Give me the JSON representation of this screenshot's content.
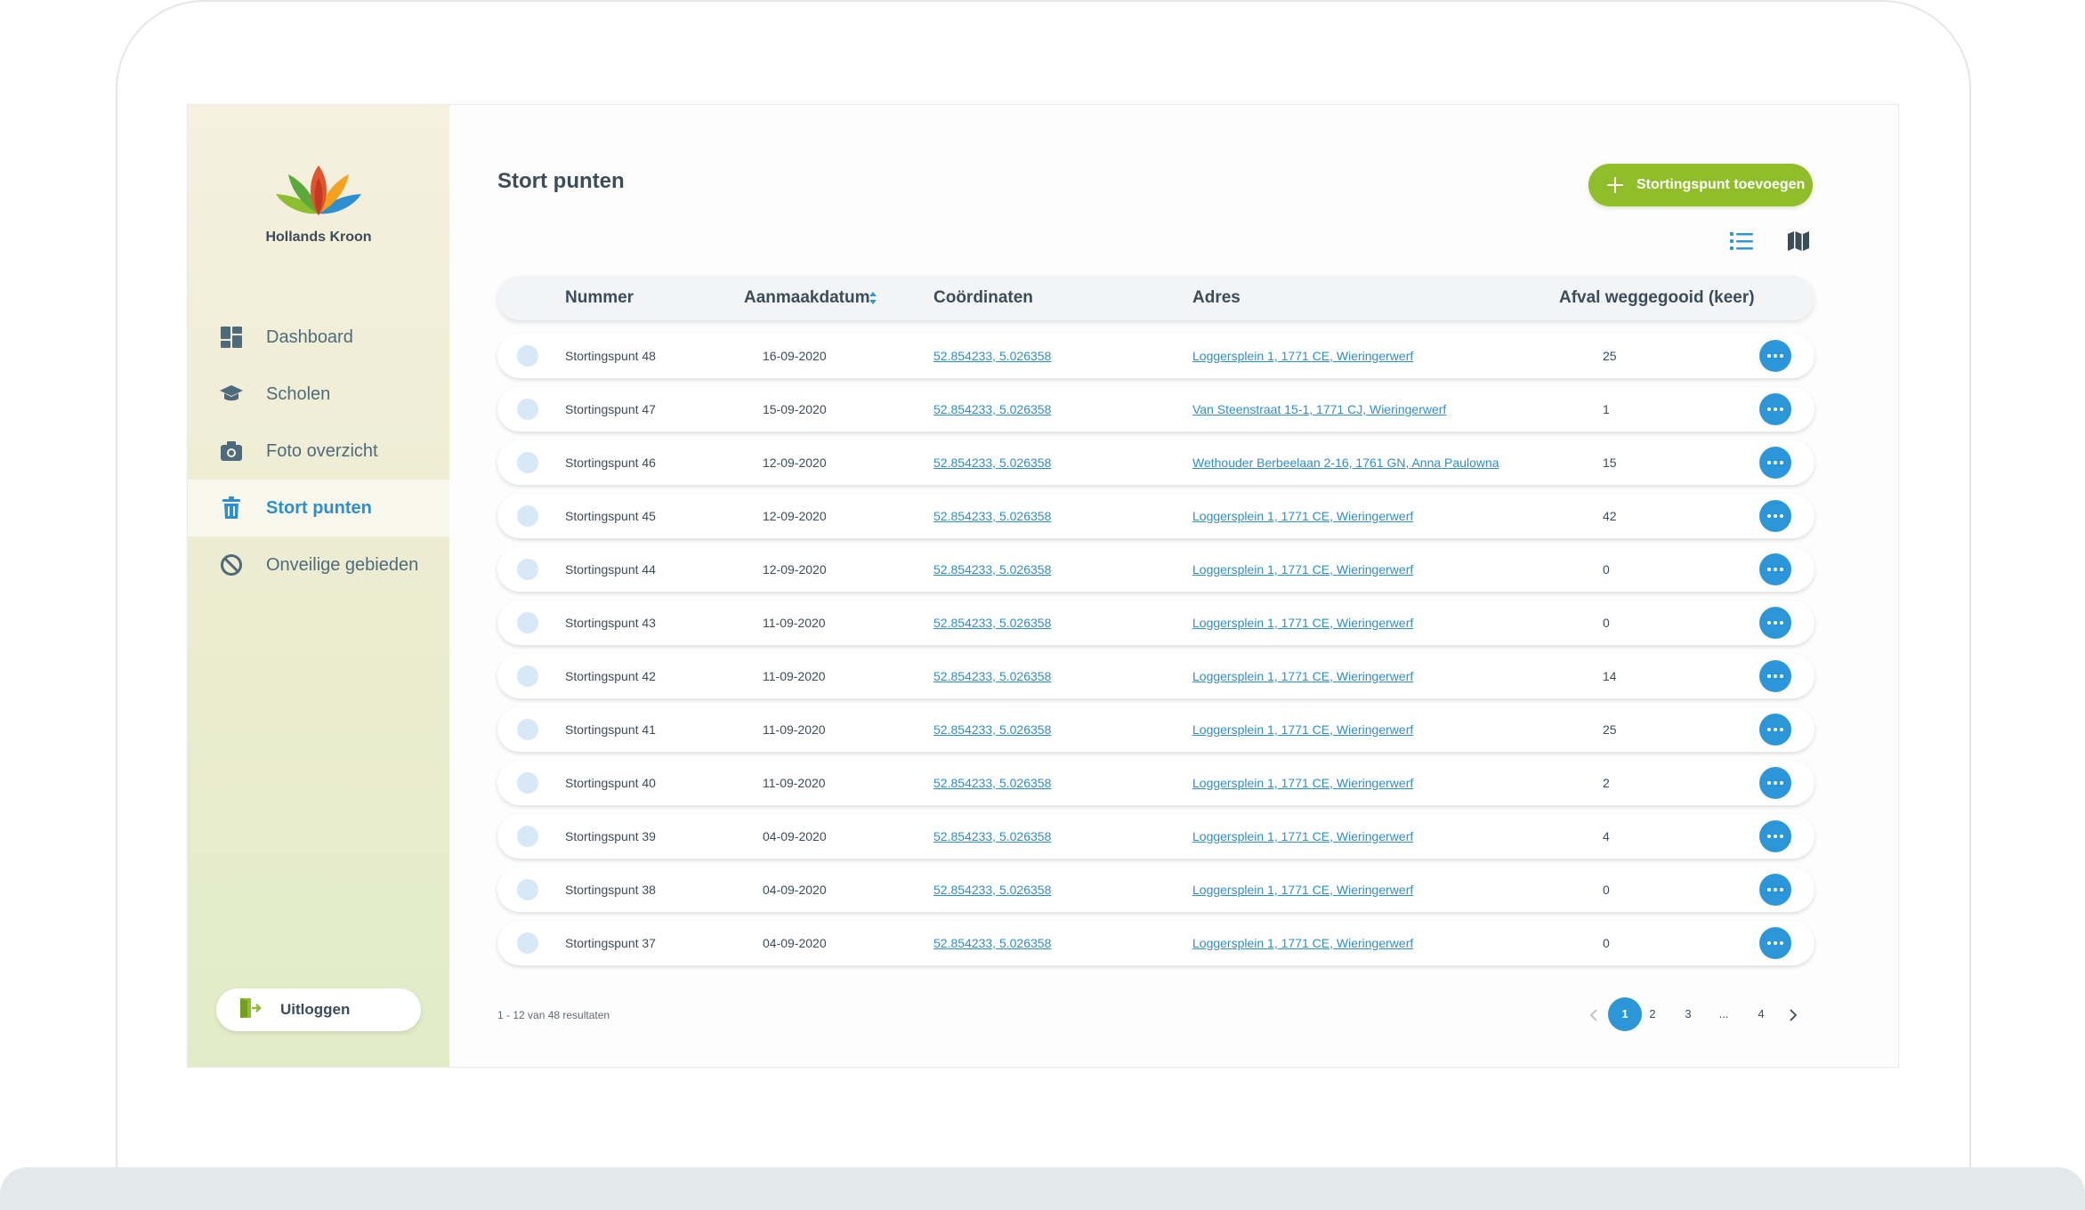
{
  "brand": {
    "name": "Hollands Kroon"
  },
  "sidebar": {
    "items": [
      {
        "label": "Dashboard",
        "icon": "dashboard-icon"
      },
      {
        "label": "Scholen",
        "icon": "graduation-cap-icon"
      },
      {
        "label": "Foto overzicht",
        "icon": "camera-icon"
      },
      {
        "label": "Stort punten",
        "icon": "trash-icon",
        "active": true
      },
      {
        "label": "Onveilige gebieden",
        "icon": "prohibited-icon"
      }
    ],
    "logout_label": "Uitloggen"
  },
  "page": {
    "title": "Stort punten",
    "add_button_label": "Stortingspunt toevoegen"
  },
  "table": {
    "columns": {
      "nummer": "Nummer",
      "aanmaakdatum": "Aanmaakdatum",
      "coordinaten": "Coördinaten",
      "adres": "Adres",
      "afval": "Afval weggegooid (keer)"
    },
    "rows": [
      {
        "nummer": "Stortingspunt 48",
        "datum": "16-09-2020",
        "coord": "52.854233, 5.026358",
        "adres": "Loggersplein 1, 1771 CE, Wieringerwerf",
        "afval": "25"
      },
      {
        "nummer": "Stortingspunt 47",
        "datum": "15-09-2020",
        "coord": "52.854233, 5.026358",
        "adres": "Van Steenstraat 15-1, 1771 CJ, Wieringerwerf",
        "afval": "1"
      },
      {
        "nummer": "Stortingspunt 46",
        "datum": "12-09-2020",
        "coord": "52.854233, 5.026358",
        "adres": "Wethouder Berbeelaan 2-16, 1761 GN, Anna Paulowna",
        "afval": "15"
      },
      {
        "nummer": "Stortingspunt 45",
        "datum": "12-09-2020",
        "coord": "52.854233, 5.026358",
        "adres": "Loggersplein 1, 1771 CE, Wieringerwerf",
        "afval": "42"
      },
      {
        "nummer": "Stortingspunt 44",
        "datum": "12-09-2020",
        "coord": "52.854233, 5.026358",
        "adres": "Loggersplein 1, 1771 CE, Wieringerwerf",
        "afval": "0"
      },
      {
        "nummer": "Stortingspunt 43",
        "datum": "11-09-2020",
        "coord": "52.854233, 5.026358",
        "adres": "Loggersplein 1, 1771 CE, Wieringerwerf",
        "afval": "0"
      },
      {
        "nummer": "Stortingspunt 42",
        "datum": "11-09-2020",
        "coord": "52.854233, 5.026358",
        "adres": "Loggersplein 1, 1771 CE, Wieringerwerf",
        "afval": "14"
      },
      {
        "nummer": "Stortingspunt 41",
        "datum": "11-09-2020",
        "coord": "52.854233, 5.026358",
        "adres": "Loggersplein 1, 1771 CE, Wieringerwerf",
        "afval": "25"
      },
      {
        "nummer": "Stortingspunt 40",
        "datum": "11-09-2020",
        "coord": "52.854233, 5.026358",
        "adres": "Loggersplein 1, 1771 CE, Wieringerwerf",
        "afval": "2"
      },
      {
        "nummer": "Stortingspunt 39",
        "datum": "04-09-2020",
        "coord": "52.854233, 5.026358",
        "adres": "Loggersplein 1, 1771 CE, Wieringerwerf",
        "afval": "4"
      },
      {
        "nummer": "Stortingspunt 38",
        "datum": "04-09-2020",
        "coord": "52.854233, 5.026358",
        "adres": "Loggersplein 1, 1771 CE, Wieringerwerf",
        "afval": "0"
      },
      {
        "nummer": "Stortingspunt 37",
        "datum": "04-09-2020",
        "coord": "52.854233, 5.026358",
        "adres": "Loggersplein 1, 1771 CE, Wieringerwerf",
        "afval": "0"
      }
    ]
  },
  "pagination": {
    "results_text": "1 - 12 van 48 resultaten",
    "pages": [
      "1",
      "2",
      "3",
      "...",
      "4"
    ],
    "current": "1"
  },
  "colors": {
    "accent_blue": "#2c97d8",
    "accent_green": "#8fbe2a",
    "text_dark": "#3c4d5a"
  }
}
